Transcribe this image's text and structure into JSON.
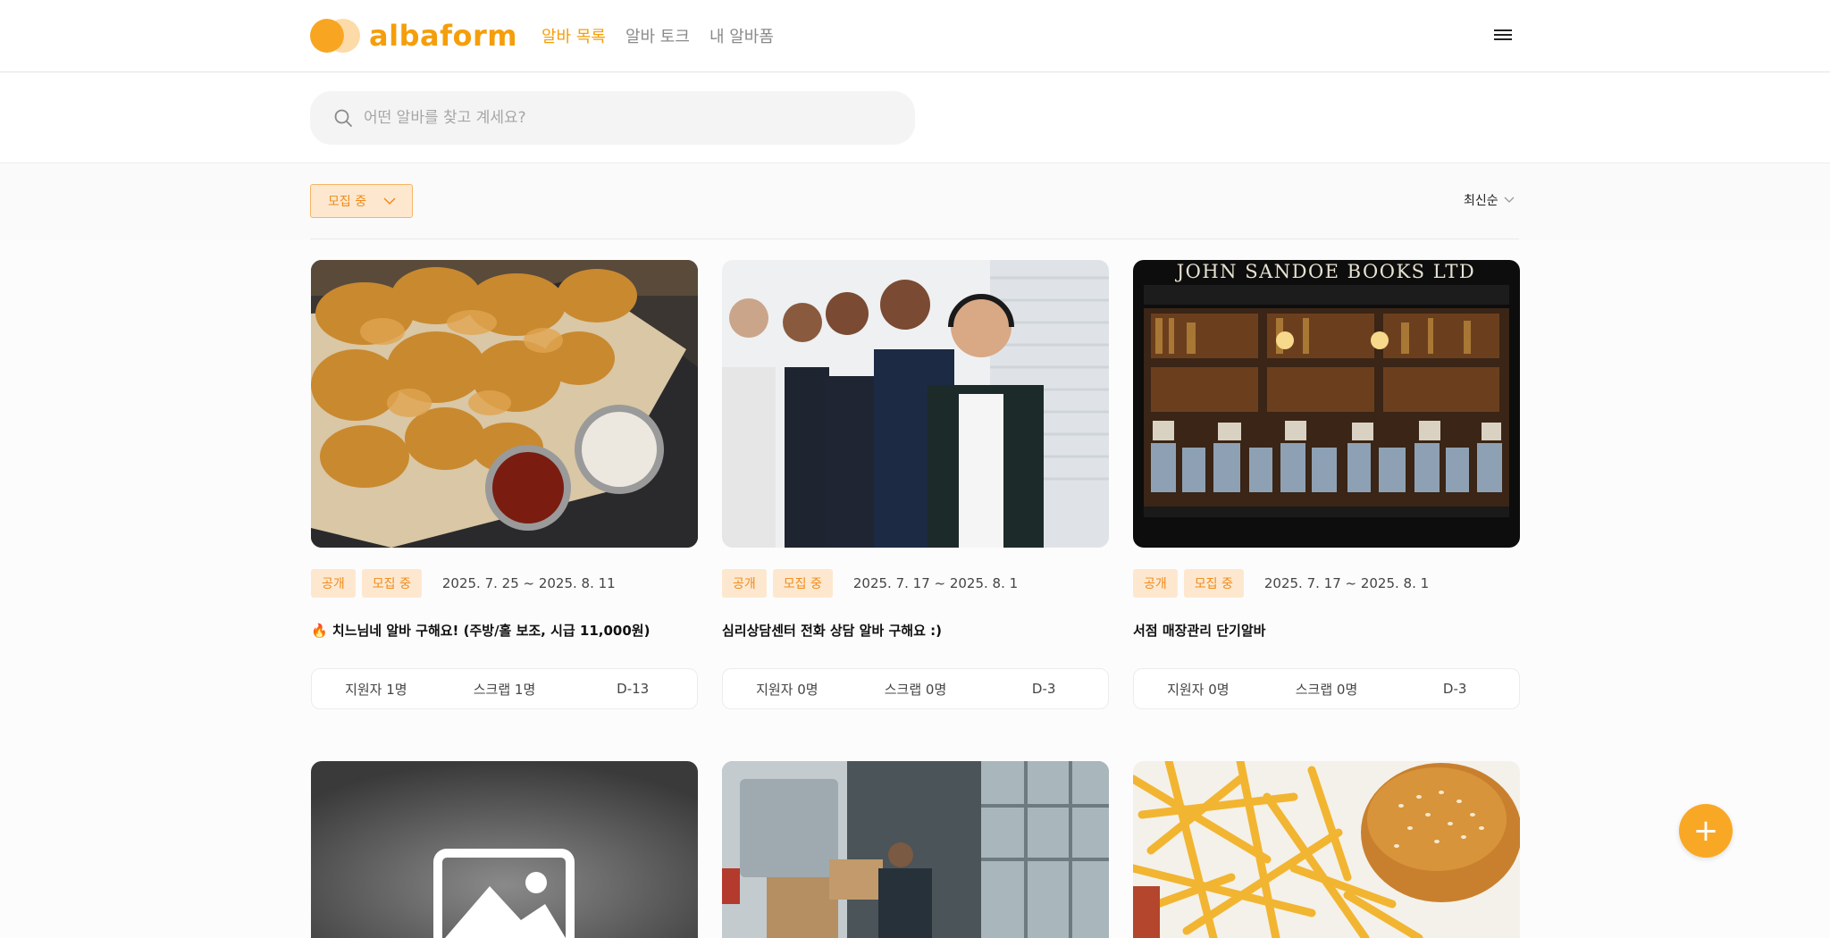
{
  "brand": {
    "name": "albaform",
    "accent": "#f59e0b"
  },
  "nav": {
    "items": [
      "알바 목록",
      "알바 토크",
      "내 알바폼"
    ],
    "active": "알바 목록"
  },
  "search": {
    "placeholder": "어떤 알바를 찾고 계세요?",
    "value": ""
  },
  "filter": {
    "status_label": "모집 중",
    "sort_label": "최신순"
  },
  "cards": [
    {
      "image": "fried-chicken-photo",
      "tags": [
        "공개",
        "모집 중"
      ],
      "dates": "2025. 7. 25 ~ 2025. 8. 11",
      "title": "🔥 치느님네 알바 구해요! (주방/홀 보조, 시급 11,000원)",
      "applicants": "지원자 1명",
      "scraps": "스크랩 1명",
      "dday": "D-13"
    },
    {
      "image": "call-center-team-photo",
      "tags": [
        "공개",
        "모집 중"
      ],
      "dates": "2025. 7. 17 ~ 2025. 8. 1",
      "title": "심리상담센터 전화 상담 알바 구해요 :)",
      "applicants": "지원자 0명",
      "scraps": "스크랩 0명",
      "dday": "D-3"
    },
    {
      "image": "bookstore-photo",
      "image_text": "JOHN SANDOE BOOKS LTD",
      "tags": [
        "공개",
        "모집 중"
      ],
      "dates": "2025. 7. 17 ~ 2025. 8. 1",
      "title": "서점 매장관리 단기알바",
      "applicants": "지원자 0명",
      "scraps": "스크랩 0명",
      "dday": "D-3"
    },
    {
      "image": "image-placeholder"
    },
    {
      "image": "delivery-van-photo"
    },
    {
      "image": "burger-fries-photo"
    }
  ],
  "fab": {
    "label": "+"
  }
}
